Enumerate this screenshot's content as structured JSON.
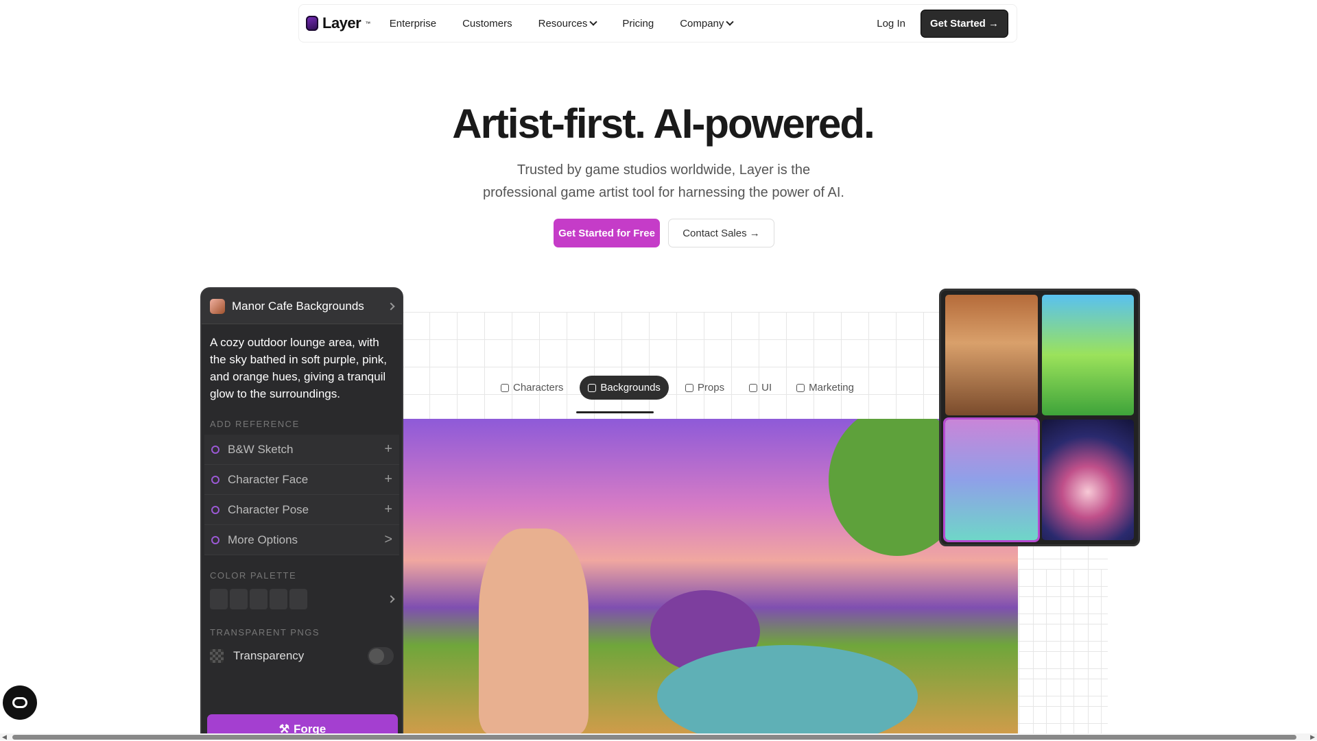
{
  "nav": {
    "logo_text": "Layer",
    "logo_tm": "™",
    "items": [
      {
        "label": "Enterprise",
        "dropdown": false
      },
      {
        "label": "Customers",
        "dropdown": false
      },
      {
        "label": "Resources",
        "dropdown": true
      },
      {
        "label": "Pricing",
        "dropdown": false
      },
      {
        "label": "Company",
        "dropdown": true
      }
    ],
    "login": "Log In",
    "get_started": "Get Started →"
  },
  "hero": {
    "title": "Artist-first. AI-powered.",
    "subtitle": "Trusted by game studios worldwide, Layer is the professional game artist tool for harnessing the power of AI.",
    "cta_primary": "Get Started for Free",
    "cta_secondary": "Contact Sales →",
    "accent_color": "#c53cc8"
  },
  "tabs": [
    {
      "label": "Characters",
      "icon": "person-icon",
      "active": false
    },
    {
      "label": "Backgrounds",
      "icon": "image-icon",
      "active": true
    },
    {
      "label": "Props",
      "icon": "person-icon",
      "active": false
    },
    {
      "label": "UI",
      "icon": "grid-icon",
      "active": false
    },
    {
      "label": "Marketing",
      "icon": "card-icon",
      "active": false
    }
  ],
  "panel": {
    "title": "Manor Cafe Backgrounds",
    "prompt": "A cozy outdoor lounge area, with the sky bathed in soft purple, pink, and orange hues, giving a tranquil glow to the surroundings.",
    "add_reference_label": "ADD REFERENCE",
    "options": [
      {
        "label": "B&W Sketch",
        "action": "+"
      },
      {
        "label": "Character Face",
        "action": "+"
      },
      {
        "label": "Character Pose",
        "action": "+"
      },
      {
        "label": "More Options",
        "action": ">"
      }
    ],
    "color_palette_label": "COLOR PALETTE",
    "transparent_label": "TRANSPARENT PNGS",
    "transparency": "Transparency",
    "transparency_on": false,
    "forge": "Forge"
  }
}
